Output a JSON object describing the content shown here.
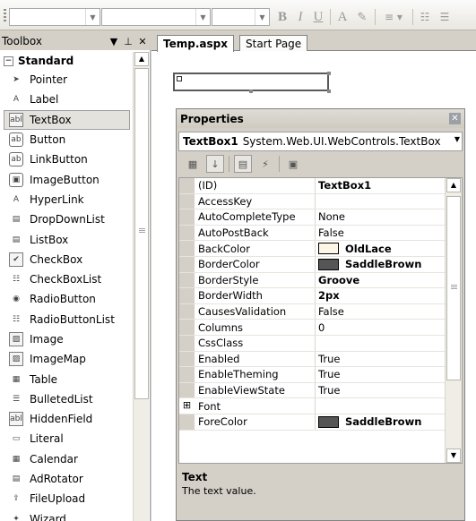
{
  "toolbar": {
    "bold_label": "B",
    "italic_label": "I",
    "underline_label": "U",
    "font_color_label": "A"
  },
  "toolbox": {
    "title": "Toolbox",
    "section": "Standard",
    "items": [
      {
        "label": "Pointer",
        "icon": "pointer-icon"
      },
      {
        "label": "Label",
        "icon": "label-icon"
      },
      {
        "label": "TextBox",
        "icon": "textbox-icon",
        "selected": true
      },
      {
        "label": "Button",
        "icon": "button-icon"
      },
      {
        "label": "LinkButton",
        "icon": "linkbutton-icon"
      },
      {
        "label": "ImageButton",
        "icon": "imagebutton-icon"
      },
      {
        "label": "HyperLink",
        "icon": "hyperlink-icon"
      },
      {
        "label": "DropDownList",
        "icon": "dropdownlist-icon"
      },
      {
        "label": "ListBox",
        "icon": "listbox-icon"
      },
      {
        "label": "CheckBox",
        "icon": "checkbox-icon"
      },
      {
        "label": "CheckBoxList",
        "icon": "checkboxlist-icon"
      },
      {
        "label": "RadioButton",
        "icon": "radiobutton-icon"
      },
      {
        "label": "RadioButtonList",
        "icon": "radiobuttonlist-icon"
      },
      {
        "label": "Image",
        "icon": "image-icon"
      },
      {
        "label": "ImageMap",
        "icon": "imagemap-icon"
      },
      {
        "label": "Table",
        "icon": "table-icon"
      },
      {
        "label": "BulletedList",
        "icon": "bulletedlist-icon"
      },
      {
        "label": "HiddenField",
        "icon": "hiddenfield-icon"
      },
      {
        "label": "Literal",
        "icon": "literal-icon"
      },
      {
        "label": "Calendar",
        "icon": "calendar-icon"
      },
      {
        "label": "AdRotator",
        "icon": "adrotator-icon"
      },
      {
        "label": "FileUpload",
        "icon": "fileupload-icon"
      },
      {
        "label": "Wizard",
        "icon": "wizard-icon"
      }
    ]
  },
  "tabs": [
    {
      "label": "Temp.aspx",
      "active": true
    },
    {
      "label": "Start Page",
      "active": false
    }
  ],
  "properties": {
    "title": "Properties",
    "object_name": "TextBox1",
    "object_type": "System.Web.UI.WebControls.TextBox",
    "rows": [
      {
        "name": "(ID)",
        "value": "TextBox1",
        "bold": true
      },
      {
        "name": "AccessKey",
        "value": ""
      },
      {
        "name": "AutoCompleteType",
        "value": "None"
      },
      {
        "name": "AutoPostBack",
        "value": "False"
      },
      {
        "name": "BackColor",
        "value": "OldLace",
        "bold": true,
        "swatch": "#fdf5e6"
      },
      {
        "name": "BorderColor",
        "value": "SaddleBrown",
        "bold": true,
        "swatch": "#555555"
      },
      {
        "name": "BorderStyle",
        "value": "Groove",
        "bold": true
      },
      {
        "name": "BorderWidth",
        "value": "2px",
        "bold": true
      },
      {
        "name": "CausesValidation",
        "value": "False"
      },
      {
        "name": "Columns",
        "value": "0"
      },
      {
        "name": "CssClass",
        "value": ""
      },
      {
        "name": "Enabled",
        "value": "True"
      },
      {
        "name": "EnableTheming",
        "value": "True"
      },
      {
        "name": "EnableViewState",
        "value": "True"
      },
      {
        "name": "Font",
        "value": "",
        "expandable": true
      },
      {
        "name": "ForeColor",
        "value": "SaddleBrown",
        "bold": true,
        "swatch": "#555555"
      }
    ],
    "description_title": "Text",
    "description_text": "The text value."
  }
}
